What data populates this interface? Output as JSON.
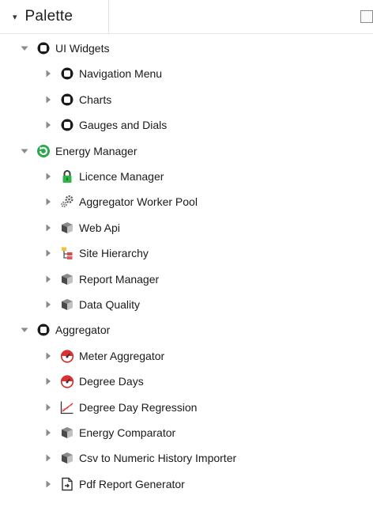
{
  "palette": {
    "title": "Palette",
    "expander_icon": "caret-down-small"
  },
  "tree": [
    {
      "label": "UI Widgets",
      "level": 0,
      "expanded": true,
      "icon": "folder-icon"
    },
    {
      "label": "Navigation Menu",
      "level": 1,
      "expanded": false,
      "icon": "folder-icon"
    },
    {
      "label": "Charts",
      "level": 1,
      "expanded": false,
      "icon": "folder-icon"
    },
    {
      "label": "Gauges and Dials",
      "level": 1,
      "expanded": false,
      "icon": "folder-icon"
    },
    {
      "label": "Energy Manager",
      "level": 0,
      "expanded": true,
      "icon": "energy-manager-icon"
    },
    {
      "label": "Licence Manager",
      "level": 1,
      "expanded": false,
      "icon": "lock-icon"
    },
    {
      "label": "Aggregator Worker Pool",
      "level": 1,
      "expanded": false,
      "icon": "gears-icon"
    },
    {
      "label": "Web Api",
      "level": 1,
      "expanded": false,
      "icon": "box-icon"
    },
    {
      "label": "Site Hierarchy",
      "level": 1,
      "expanded": false,
      "icon": "hierarchy-icon"
    },
    {
      "label": "Report Manager",
      "level": 1,
      "expanded": false,
      "icon": "box-icon"
    },
    {
      "label": "Data Quality",
      "level": 1,
      "expanded": false,
      "icon": "box-icon"
    },
    {
      "label": "Aggregator",
      "level": 0,
      "expanded": true,
      "icon": "folder-icon"
    },
    {
      "label": "Meter Aggregator",
      "level": 1,
      "expanded": false,
      "icon": "meter-icon"
    },
    {
      "label": "Degree Days",
      "level": 1,
      "expanded": false,
      "icon": "meter-icon"
    },
    {
      "label": "Degree Day Regression",
      "level": 1,
      "expanded": false,
      "icon": "regression-chart-icon"
    },
    {
      "label": "Energy Comparator",
      "level": 1,
      "expanded": false,
      "icon": "box-icon"
    },
    {
      "label": "Csv to Numeric History Importer",
      "level": 1,
      "expanded": false,
      "icon": "box-icon"
    },
    {
      "label": "Pdf Report Generator",
      "level": 1,
      "expanded": false,
      "icon": "report-icon"
    }
  ]
}
